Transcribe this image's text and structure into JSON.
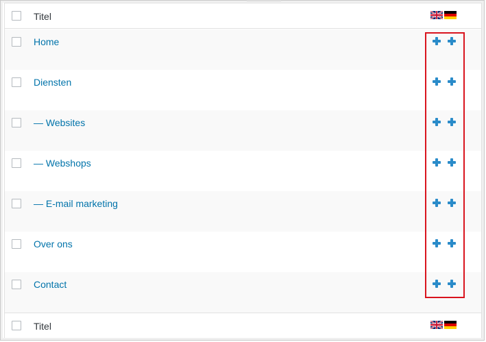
{
  "columns": {
    "title_label": "Titel"
  },
  "footer": {
    "title_label": "Titel"
  },
  "languages": [
    {
      "code": "en",
      "icon": "uk-flag-icon"
    },
    {
      "code": "de",
      "icon": "german-flag-icon"
    }
  ],
  "pages": [
    {
      "title": "Home"
    },
    {
      "title": "Diensten"
    },
    {
      "title": "— Websites"
    },
    {
      "title": "— Webshops"
    },
    {
      "title": "— E-mail marketing"
    },
    {
      "title": "Over ons"
    },
    {
      "title": "Contact"
    }
  ],
  "colors": {
    "link": "#0073aa",
    "plus": "#2a8bc9",
    "highlight": "#d9131d"
  }
}
